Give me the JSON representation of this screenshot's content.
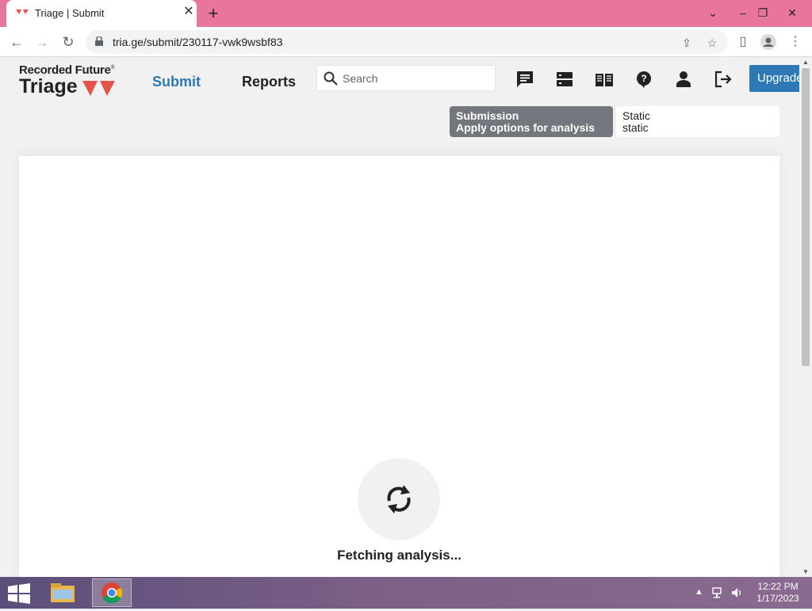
{
  "browser": {
    "tab_title": "Triage | Submit",
    "url": "tria.ge/submit/230117-vwk9wsbf83"
  },
  "site": {
    "logo_top": "Recorded Future",
    "logo_mark": "®",
    "logo_bottom": "Triage",
    "nav": {
      "submit": "Submit",
      "reports": "Reports"
    },
    "search_placeholder": "Search",
    "upgrade_label": "Upgrade",
    "submission": {
      "title": "Submission",
      "subtitle": "Apply options for analysis"
    },
    "static": {
      "title": "Static",
      "subtitle": "static"
    },
    "status_text": "Fetching analysis...",
    "accent_color": "#2e79b5",
    "brand_red": "#e5534b"
  },
  "taskbar": {
    "time": "12:22 PM",
    "date": "1/17/2023"
  }
}
